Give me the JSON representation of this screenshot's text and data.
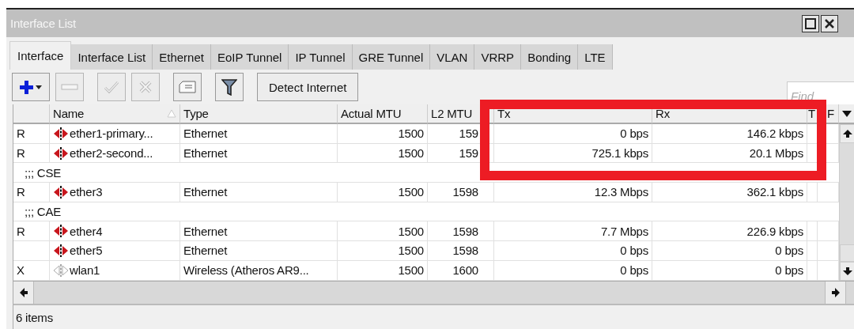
{
  "window": {
    "title": "Interface List"
  },
  "tabs": [
    {
      "label": "Interface",
      "selected": true
    },
    {
      "label": "Interface List",
      "selected": false
    },
    {
      "label": "Ethernet",
      "selected": false
    },
    {
      "label": "EoIP Tunnel",
      "selected": false
    },
    {
      "label": "IP Tunnel",
      "selected": false
    },
    {
      "label": "GRE Tunnel",
      "selected": false
    },
    {
      "label": "VLAN",
      "selected": false
    },
    {
      "label": "VRRP",
      "selected": false
    },
    {
      "label": "Bonding",
      "selected": false
    },
    {
      "label": "LTE",
      "selected": false
    }
  ],
  "toolbar": [
    {
      "kind": "add",
      "disabled": false
    },
    {
      "kind": "remove",
      "disabled": true
    },
    {
      "kind": "enable",
      "disabled": true
    },
    {
      "kind": "disable",
      "disabled": true
    },
    {
      "kind": "comment",
      "disabled": false
    },
    {
      "kind": "filter",
      "disabled": false
    },
    {
      "kind": "text",
      "label": "Detect Internet",
      "disabled": false
    }
  ],
  "search": {
    "placeholder": "Find"
  },
  "table": {
    "columns": [
      {
        "label": "Name",
        "sorted": true
      },
      {
        "label": "Type",
        "sorted": false
      },
      {
        "label": "Actual MTU",
        "sorted": false
      },
      {
        "label": "L2 MTU",
        "sorted": false
      },
      {
        "label": "Tx",
        "sorted": false
      },
      {
        "label": "Rx",
        "sorted": false
      },
      {
        "label": "T",
        "sorted": false
      },
      {
        "label": "F",
        "sorted": false
      }
    ],
    "rows": [
      {
        "kind": "interface",
        "flag": "R",
        "name": "ether1-primary...",
        "type": "Ethernet",
        "actual_mtu": "1500",
        "l2_mtu": "159",
        "tx": "0 bps",
        "rx": "146.2 kbps",
        "disabled": false
      },
      {
        "kind": "interface",
        "flag": "R",
        "name": "ether2-second...",
        "type": "Ethernet",
        "actual_mtu": "1500",
        "l2_mtu": "159",
        "tx": "725.1 kbps",
        "rx": "20.1 Mbps",
        "disabled": false
      },
      {
        "kind": "comment",
        "text": ";;; CSE"
      },
      {
        "kind": "interface",
        "flag": "R",
        "name": "ether3",
        "type": "Ethernet",
        "actual_mtu": "1500",
        "l2_mtu": "1598",
        "tx": "12.3 Mbps",
        "rx": "362.1 kbps",
        "disabled": false
      },
      {
        "kind": "comment",
        "text": ";;; CAE"
      },
      {
        "kind": "interface",
        "flag": "R",
        "name": "ether4",
        "type": "Ethernet",
        "actual_mtu": "1500",
        "l2_mtu": "1598",
        "tx": "7.7 Mbps",
        "rx": "226.9 kbps",
        "disabled": false
      },
      {
        "kind": "interface",
        "name": "ether5",
        "type": "Ethernet",
        "actual_mtu": "1500",
        "l2_mtu": "1598",
        "tx": "0 bps",
        "rx": "0 bps",
        "disabled": false
      },
      {
        "kind": "interface",
        "flag": "X",
        "name": "wlan1",
        "type": "Wireless (Atheros AR9...",
        "actual_mtu": "1500",
        "l2_mtu": "1600",
        "tx": "0 bps",
        "rx": "0 bps",
        "disabled": true
      }
    ]
  },
  "status_bar": {
    "text": "6 items"
  },
  "annotation": {
    "kind": "rectangle",
    "color": "#ed1c24"
  }
}
